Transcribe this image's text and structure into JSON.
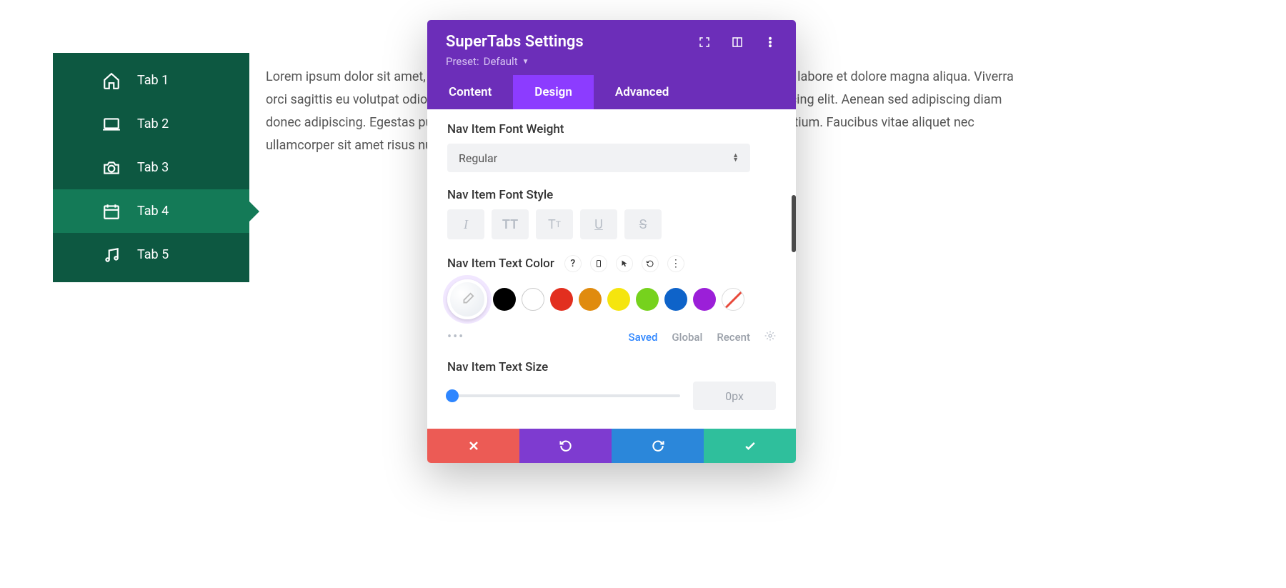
{
  "nav": {
    "items": [
      {
        "label": "Tab 1",
        "icon": "home"
      },
      {
        "label": "Tab 2",
        "icon": "laptop"
      },
      {
        "label": "Tab 3",
        "icon": "camera"
      },
      {
        "label": "Tab 4",
        "icon": "calendar",
        "active": true
      },
      {
        "label": "Tab 5",
        "icon": "music"
      }
    ]
  },
  "body_text": "Lorem ipsum dolor sit amet, consectetur adipiscing elit, sed do eiusmod tempor incididunt ut labore et dolore magna aliqua. Viverra orci sagittis eu volutpat odio facilisis mauris. Lorem ipsum dolor sit amet consectetur adipiscing elit. Aenean sed adipiscing diam donec adipiscing. Egestas purus viverra accumsan in nisl nisi scelerisque id velit ut tortor pretium. Faucibus vitae aliquet nec ullamcorper sit amet risus nullam eget.",
  "modal": {
    "title": "SuperTabs Settings",
    "preset_label": "Preset:",
    "preset_value": "Default",
    "tabs": [
      {
        "label": "Content"
      },
      {
        "label": "Design",
        "active": true
      },
      {
        "label": "Advanced"
      }
    ],
    "fields": {
      "font_weight": {
        "label": "Nav Item Font Weight",
        "value": "Regular"
      },
      "font_style": {
        "label": "Nav Item Font Style"
      },
      "text_color": {
        "label": "Nav Item Text Color"
      },
      "text_size": {
        "label": "Nav Item Text Size",
        "value": "0px"
      }
    },
    "color_swatches": [
      "#000000",
      "#ffffff",
      "#e22f1f",
      "#e08b0e",
      "#f5e50e",
      "#76d21d",
      "#0e63c9",
      "#9b1fd8"
    ],
    "palette_tabs": {
      "saved": "Saved",
      "global": "Global",
      "recent": "Recent",
      "active": "saved"
    }
  }
}
